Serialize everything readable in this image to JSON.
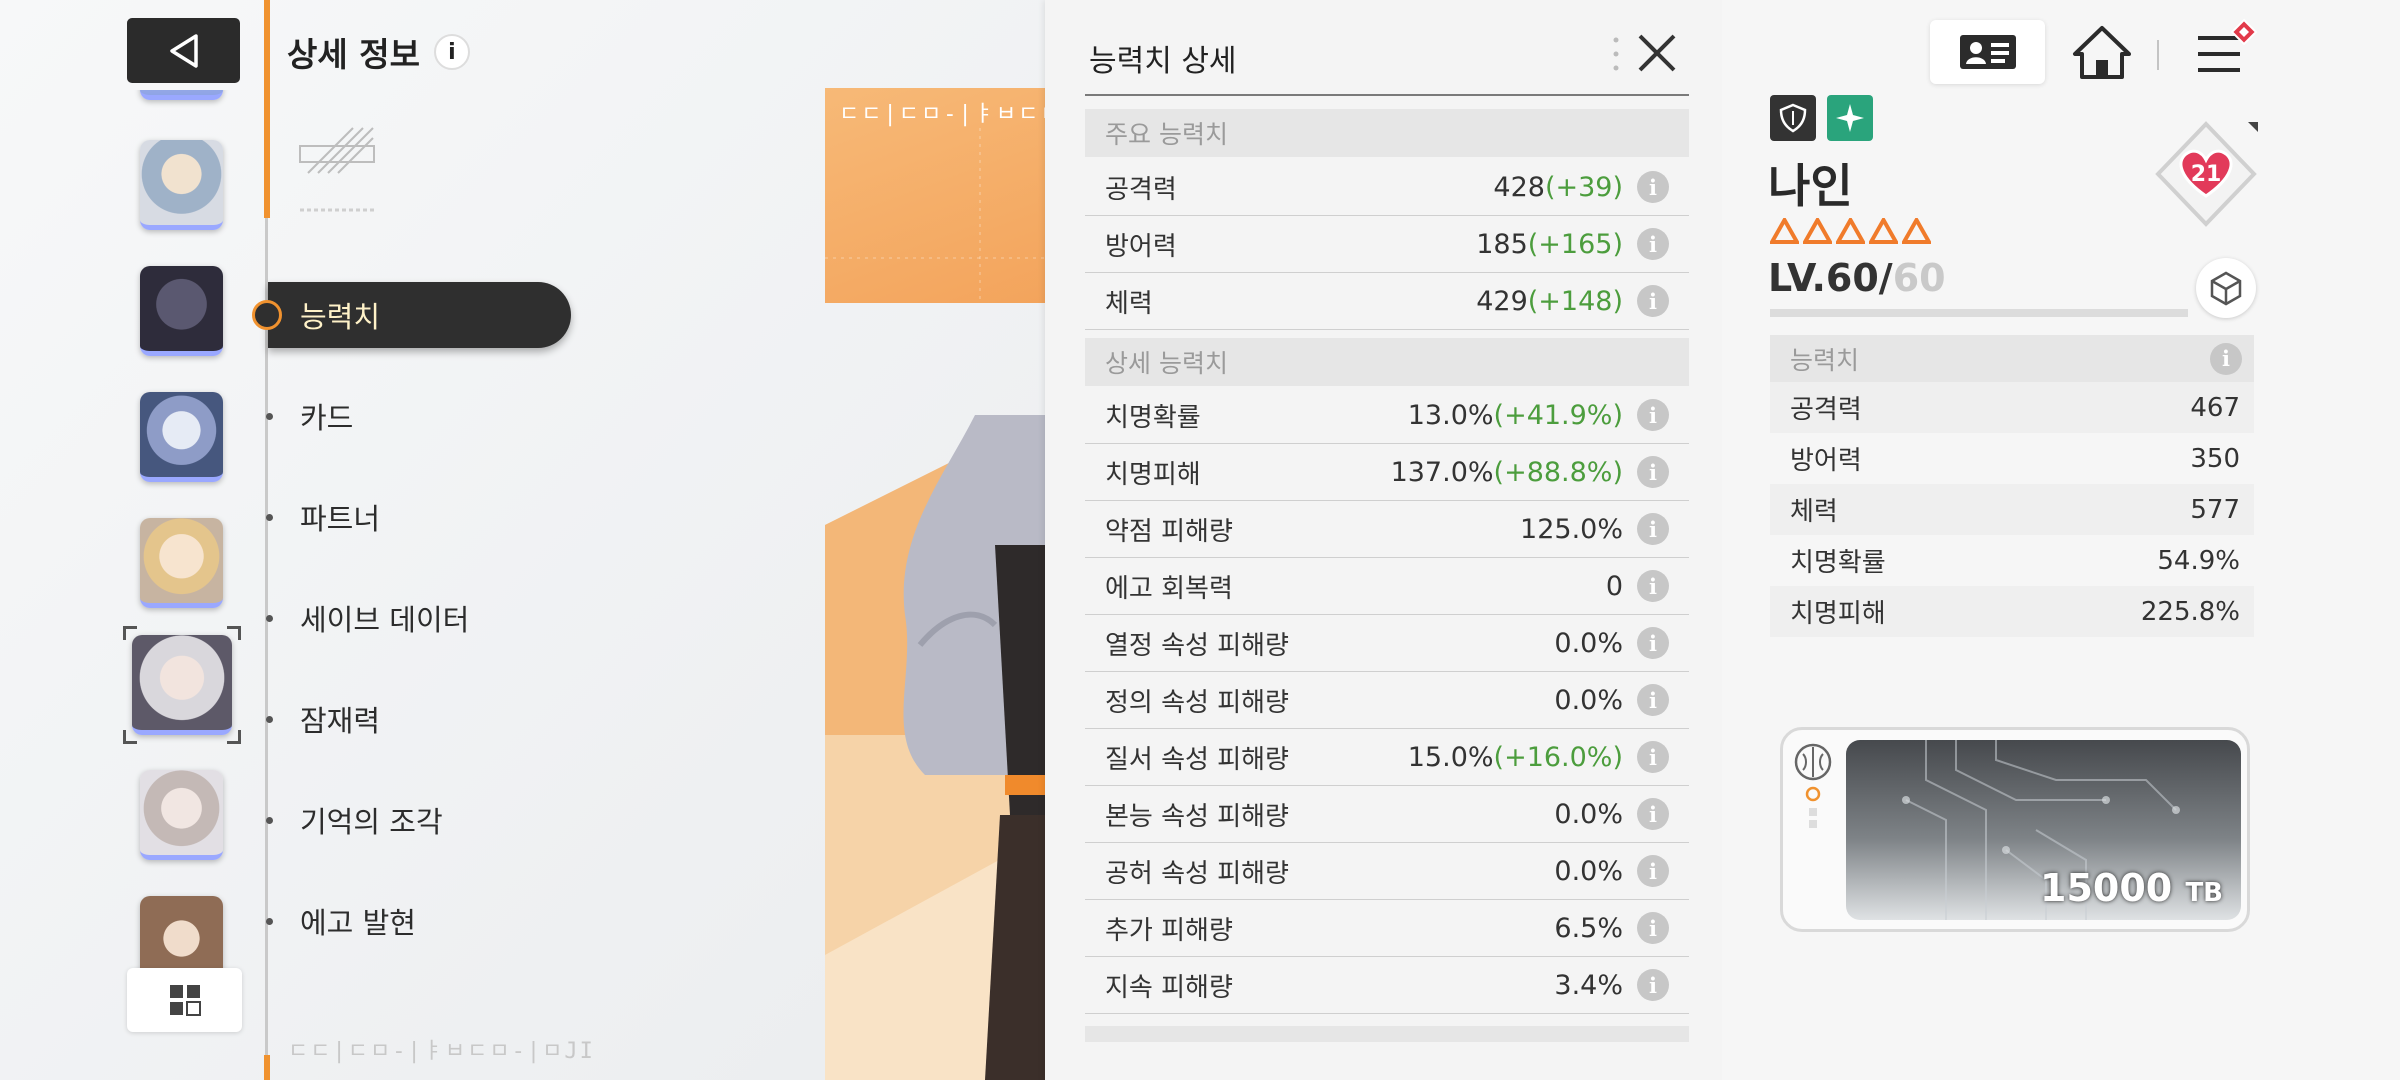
{
  "header": {
    "title": "상세 정보",
    "info_icon": "i"
  },
  "left_menu": {
    "items": [
      {
        "label": "능력치",
        "active": true
      },
      {
        "label": "카드",
        "active": false
      },
      {
        "label": "파트너",
        "active": false
      },
      {
        "label": "세이브 데이터",
        "active": false
      },
      {
        "label": "잠재력",
        "active": false
      },
      {
        "label": "기억의 조각",
        "active": false
      },
      {
        "label": "에고 발현",
        "active": false
      }
    ]
  },
  "banner": {
    "text": "ㄷㄷ|ㄷㅁ-|ㅑㅂㄷㅁ-|ㅁJI"
  },
  "watermark": "ㄷㄷ|ㄷㅁ-|ㅑㅂㄷㅁ-|ㅁJI",
  "detail_panel": {
    "title": "능력치 상세",
    "main_section": "주요 능력치",
    "main_stats": [
      {
        "label": "공격력",
        "value": "428",
        "bonus": "(+39)"
      },
      {
        "label": "방어력",
        "value": "185",
        "bonus": "(+165)"
      },
      {
        "label": "체력",
        "value": "429",
        "bonus": "(+148)"
      }
    ],
    "sub_section": "상세 능력치",
    "sub_stats": [
      {
        "label": "치명확률",
        "value": "13.0%",
        "bonus": "(+41.9%)"
      },
      {
        "label": "치명피해",
        "value": "137.0%",
        "bonus": "(+88.8%)"
      },
      {
        "label": "약점 피해량",
        "value": "125.0%",
        "bonus": ""
      },
      {
        "label": "에고 회복력",
        "value": "0",
        "bonus": ""
      },
      {
        "label": "열정 속성 피해량",
        "value": "0.0%",
        "bonus": ""
      },
      {
        "label": "정의 속성 피해량",
        "value": "0.0%",
        "bonus": ""
      },
      {
        "label": "질서 속성 피해량",
        "value": "15.0%",
        "bonus": "(+16.0%)"
      },
      {
        "label": "본능 속성 피해량",
        "value": "0.0%",
        "bonus": ""
      },
      {
        "label": "공허 속성 피해량",
        "value": "0.0%",
        "bonus": ""
      },
      {
        "label": "추가 피해량",
        "value": "6.5%",
        "bonus": ""
      },
      {
        "label": "지속 피해량",
        "value": "3.4%",
        "bonus": ""
      }
    ]
  },
  "character": {
    "name": "나인",
    "rarity_stars": 5,
    "level_current": "LV.60/",
    "level_max": "60",
    "affection": "21",
    "stats_title": "능력치",
    "stats": [
      {
        "label": "공격력",
        "value": "467"
      },
      {
        "label": "방어력",
        "value": "350"
      },
      {
        "label": "체력",
        "value": "577"
      },
      {
        "label": "치명확률",
        "value": "54.9%"
      },
      {
        "label": "치명피해",
        "value": "225.8%"
      }
    ],
    "storage_value": "15000",
    "storage_unit": "TB"
  },
  "colors": {
    "accent": "#f0922f",
    "bonus_green": "#4c9d3d",
    "dark": "#2f2f2f"
  },
  "icons": [
    "back-arrow-icon",
    "info-icon",
    "close-icon",
    "profile-card-icon",
    "home-icon",
    "hamburger-menu-icon",
    "cube-icon",
    "heart-icon",
    "brain-icon",
    "grid-icon",
    "shield-icon",
    "star-icon"
  ]
}
